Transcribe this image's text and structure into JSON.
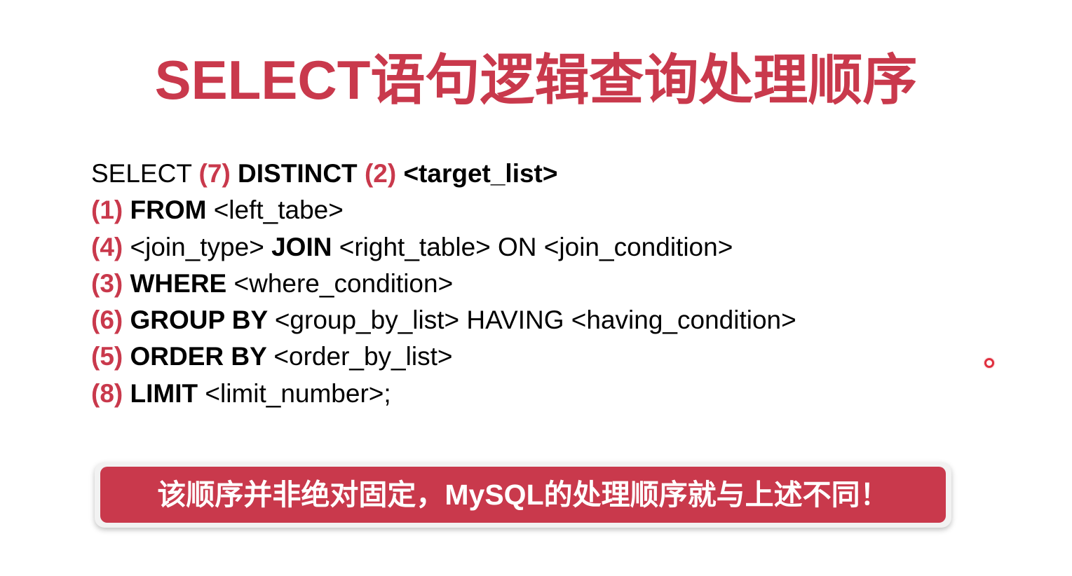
{
  "title": "SELECT语句逻辑查询处理顺序",
  "lines": [
    {
      "parts": [
        {
          "t": "SELECT ",
          "s": "txt"
        },
        {
          "t": "(7) ",
          "s": "num"
        },
        {
          "t": "DISTINCT ",
          "s": "kw"
        },
        {
          "t": "(2) ",
          "s": "num"
        },
        {
          "t": "<target_list>",
          "s": "kw"
        }
      ]
    },
    {
      "parts": [
        {
          "t": "(1) ",
          "s": "num"
        },
        {
          "t": "FROM ",
          "s": "kw"
        },
        {
          "t": "<left_tabe>",
          "s": "txt"
        }
      ]
    },
    {
      "parts": [
        {
          "t": "(4) ",
          "s": "num"
        },
        {
          "t": "<join_type> ",
          "s": "txt"
        },
        {
          "t": "JOIN ",
          "s": "kw"
        },
        {
          "t": "<right_table> ON <join_condition>",
          "s": "txt"
        }
      ]
    },
    {
      "parts": [
        {
          "t": "(3) ",
          "s": "num"
        },
        {
          "t": "WHERE ",
          "s": "kw"
        },
        {
          "t": "<where_condition>",
          "s": "txt"
        }
      ]
    },
    {
      "parts": [
        {
          "t": "(6) ",
          "s": "num"
        },
        {
          "t": "GROUP BY ",
          "s": "kw"
        },
        {
          "t": "<group_by_list> HAVING <having_condition>",
          "s": "txt"
        }
      ]
    },
    {
      "parts": [
        {
          "t": "(5) ",
          "s": "num"
        },
        {
          "t": "ORDER BY ",
          "s": "kw"
        },
        {
          "t": "<order_by_list>",
          "s": "txt"
        }
      ]
    },
    {
      "parts": [
        {
          "t": "(8) ",
          "s": "num"
        },
        {
          "t": "LIMIT ",
          "s": "kw"
        },
        {
          "t": "<limit_number>;",
          "s": "txt"
        }
      ]
    }
  ],
  "note": "该顺序并非绝对固定，MySQL的处理顺序就与上述不同！",
  "colors": {
    "accent": "#c9394c",
    "text": "#000000",
    "background": "#ffffff"
  },
  "pointer_icon": "laser-pointer-icon"
}
